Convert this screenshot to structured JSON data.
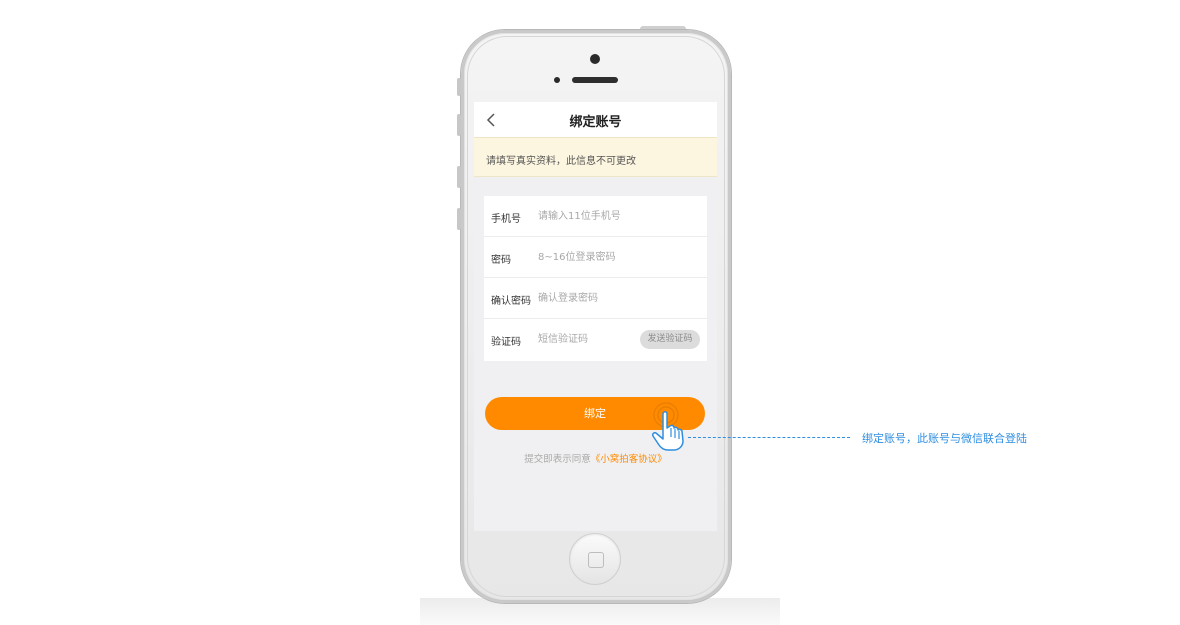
{
  "navbar": {
    "title": "绑定账号",
    "back_icon": "chevron-left-icon"
  },
  "notice": {
    "text": "请填写真实资料，此信息不可更改"
  },
  "form": {
    "phone": {
      "label": "手机号",
      "placeholder": "请输入11位手机号",
      "value": ""
    },
    "password": {
      "label": "密码",
      "placeholder": "8~16位登录密码",
      "value": ""
    },
    "confirm_password": {
      "label": "确认密码",
      "placeholder": "确认登录密码",
      "value": ""
    },
    "verification_code": {
      "label": "验证码",
      "placeholder": "短信验证码",
      "value": "",
      "send_button": "发送验证码"
    }
  },
  "bind_button": {
    "label": "绑定"
  },
  "agreement": {
    "prefix": "提交即表示同意",
    "link": "《小窝拍客协议》"
  },
  "annotation": {
    "text": "绑定账号，此账号与微信联合登陆",
    "pointer_icon": "hand-pointer-icon"
  },
  "colors": {
    "accent": "#ff8a00",
    "annotation": "#2f8ee0",
    "notice_bg": "#fcf5df",
    "screen_bg": "#f0f0f2"
  }
}
